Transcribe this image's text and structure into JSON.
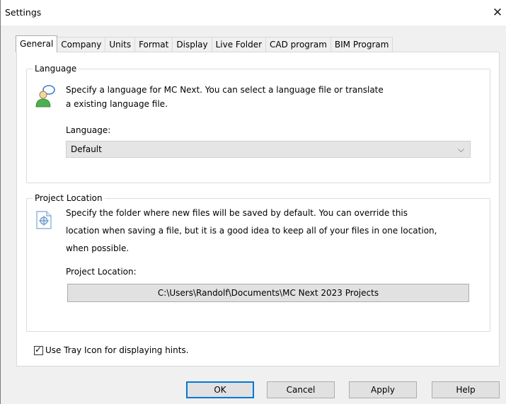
{
  "window": {
    "title": "Settings",
    "close_glyph": "✕"
  },
  "tabs": [
    {
      "label": "General",
      "active": true
    },
    {
      "label": "Company",
      "active": false
    },
    {
      "label": "Units",
      "active": false
    },
    {
      "label": "Format",
      "active": false
    },
    {
      "label": "Display",
      "active": false
    },
    {
      "label": "Live Folder",
      "active": false
    },
    {
      "label": "CAD program",
      "active": false
    },
    {
      "label": "BIM Program",
      "active": false
    }
  ],
  "language": {
    "group_title": "Language",
    "icon": "language-people-icon",
    "description_line1": "Specify a language for MC Next. You can select a language file or translate",
    "description_line2": "a existing language file.",
    "field_label": "Language:",
    "selected_value": "Default",
    "dropdown_glyph": "⌵"
  },
  "project": {
    "group_title": "Project Location",
    "icon": "folder-location-icon",
    "description_line1": "Specify the folder where new files will be saved by default. You can override this",
    "description_line2": "location when saving a file, but it is a good idea to keep all of your files in one location,",
    "description_line3": "when possible.",
    "field_label": "Project Location:",
    "path_value": "C:\\Users\\Randolf\\Documents\\MC Next 2023 Projects"
  },
  "tray_icon": {
    "label": "Use Tray Icon for displaying hints.",
    "checked": true,
    "check_glyph": "✓"
  },
  "buttons": {
    "ok": "OK",
    "cancel": "Cancel",
    "apply": "Apply",
    "help": "Help"
  },
  "colors": {
    "default_button_border": "#0078d7",
    "dialog_bg": "#f0f0f0",
    "panel_bg": "#ffffff"
  }
}
